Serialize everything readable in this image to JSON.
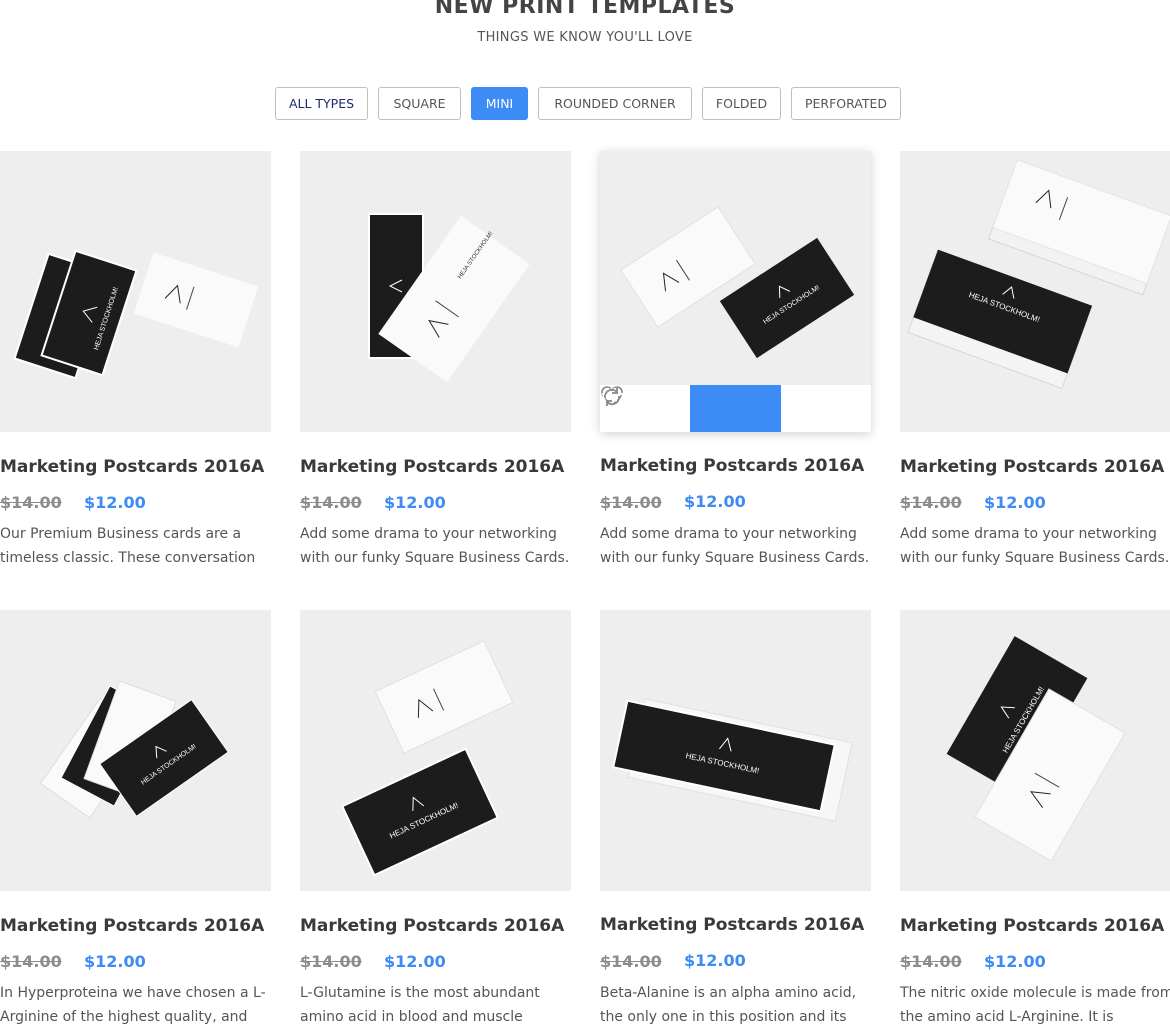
{
  "header": {
    "title": "NEW PRINT TEMPLATES",
    "subtitle": "THINGS WE KNOW YOU'LL LOVE"
  },
  "filters": [
    {
      "label": "ALL TYPES"
    },
    {
      "label": "SQUARE"
    },
    {
      "label": "MINI",
      "active": true
    },
    {
      "label": "ROUNDED CORNER"
    },
    {
      "label": "FOLDED"
    },
    {
      "label": "PERFORATED"
    }
  ],
  "colors": {
    "accent": "#3d8bf5",
    "card_dark": "#1c1c1c",
    "card_light": "#fafafa"
  },
  "card_brand_text": "HEJA STOCKHOLM!",
  "products": [
    {
      "title": "Marketing Postcards 2016A",
      "old_price": "$14.00",
      "price": "$12.00",
      "description": "Our Premium Business cards are a timeless classic. These conversation"
    },
    {
      "title": "Marketing Postcards 2016A",
      "old_price": "$14.00",
      "price": "$12.00",
      "description": "Add some drama to your networking with our funky Square Business Cards."
    },
    {
      "title": "Marketing Postcards 2016A",
      "old_price": "$14.00",
      "price": "$12.00",
      "description": "Add some drama to your networking with our funky Square Business Cards.",
      "hover": true
    },
    {
      "title": "Marketing Postcards 2016A",
      "old_price": "$14.00",
      "price": "$12.00",
      "description": "Add some drama to your networking with our funky Square Business Cards."
    },
    {
      "title": "Marketing Postcards 2016A",
      "old_price": "$14.00",
      "price": "$12.00",
      "description": "In Hyperproteina we have chosen a L-Arginine of the highest quality, and"
    },
    {
      "title": "Marketing Postcards 2016A",
      "old_price": "$14.00",
      "price": "$12.00",
      "description": "L-Glutamine is the most abundant amino acid in blood and muscle"
    },
    {
      "title": "Marketing Postcards 2016A",
      "old_price": "$14.00",
      "price": "$12.00",
      "description": "Beta-Alanine is an alpha amino acid, the only one in this position and its"
    },
    {
      "title": "Marketing Postcards 2016A",
      "old_price": "$14.00",
      "price": "$12.00",
      "description": "The nitric oxide molecule is made from the amino acid L-Arginine. It is"
    }
  ],
  "hover_actions": [
    "heart-icon",
    "basket-icon",
    "refresh-icon"
  ]
}
